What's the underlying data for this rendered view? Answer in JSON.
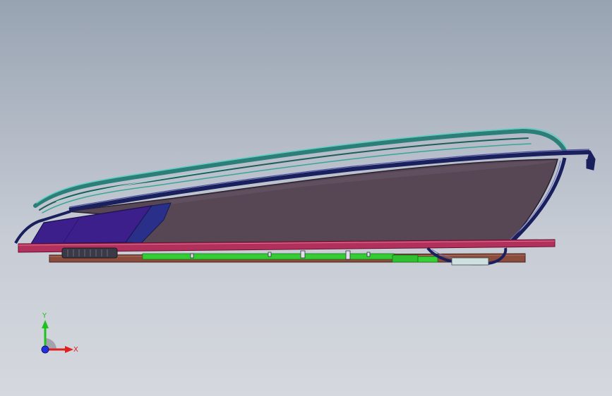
{
  "viewport": {
    "background_top": "#98a3b2",
    "background_bottom": "#d5d8de"
  },
  "model": {
    "colors": {
      "teal_rails": "#2f8f86",
      "navy_frame": "#1a1f5e",
      "glass_panel": "#5a4855",
      "purple_panel": "#3a1a8a",
      "magenta_rail": "#b0305a",
      "brown_base": "#8a5040",
      "green_bracket": "#33cc33",
      "dark_parts": "#303040"
    }
  },
  "triad": {
    "x_label": "X",
    "y_label": "Y",
    "x_color": "#e02020",
    "y_color": "#20c020",
    "z_color": "#2030e0"
  }
}
